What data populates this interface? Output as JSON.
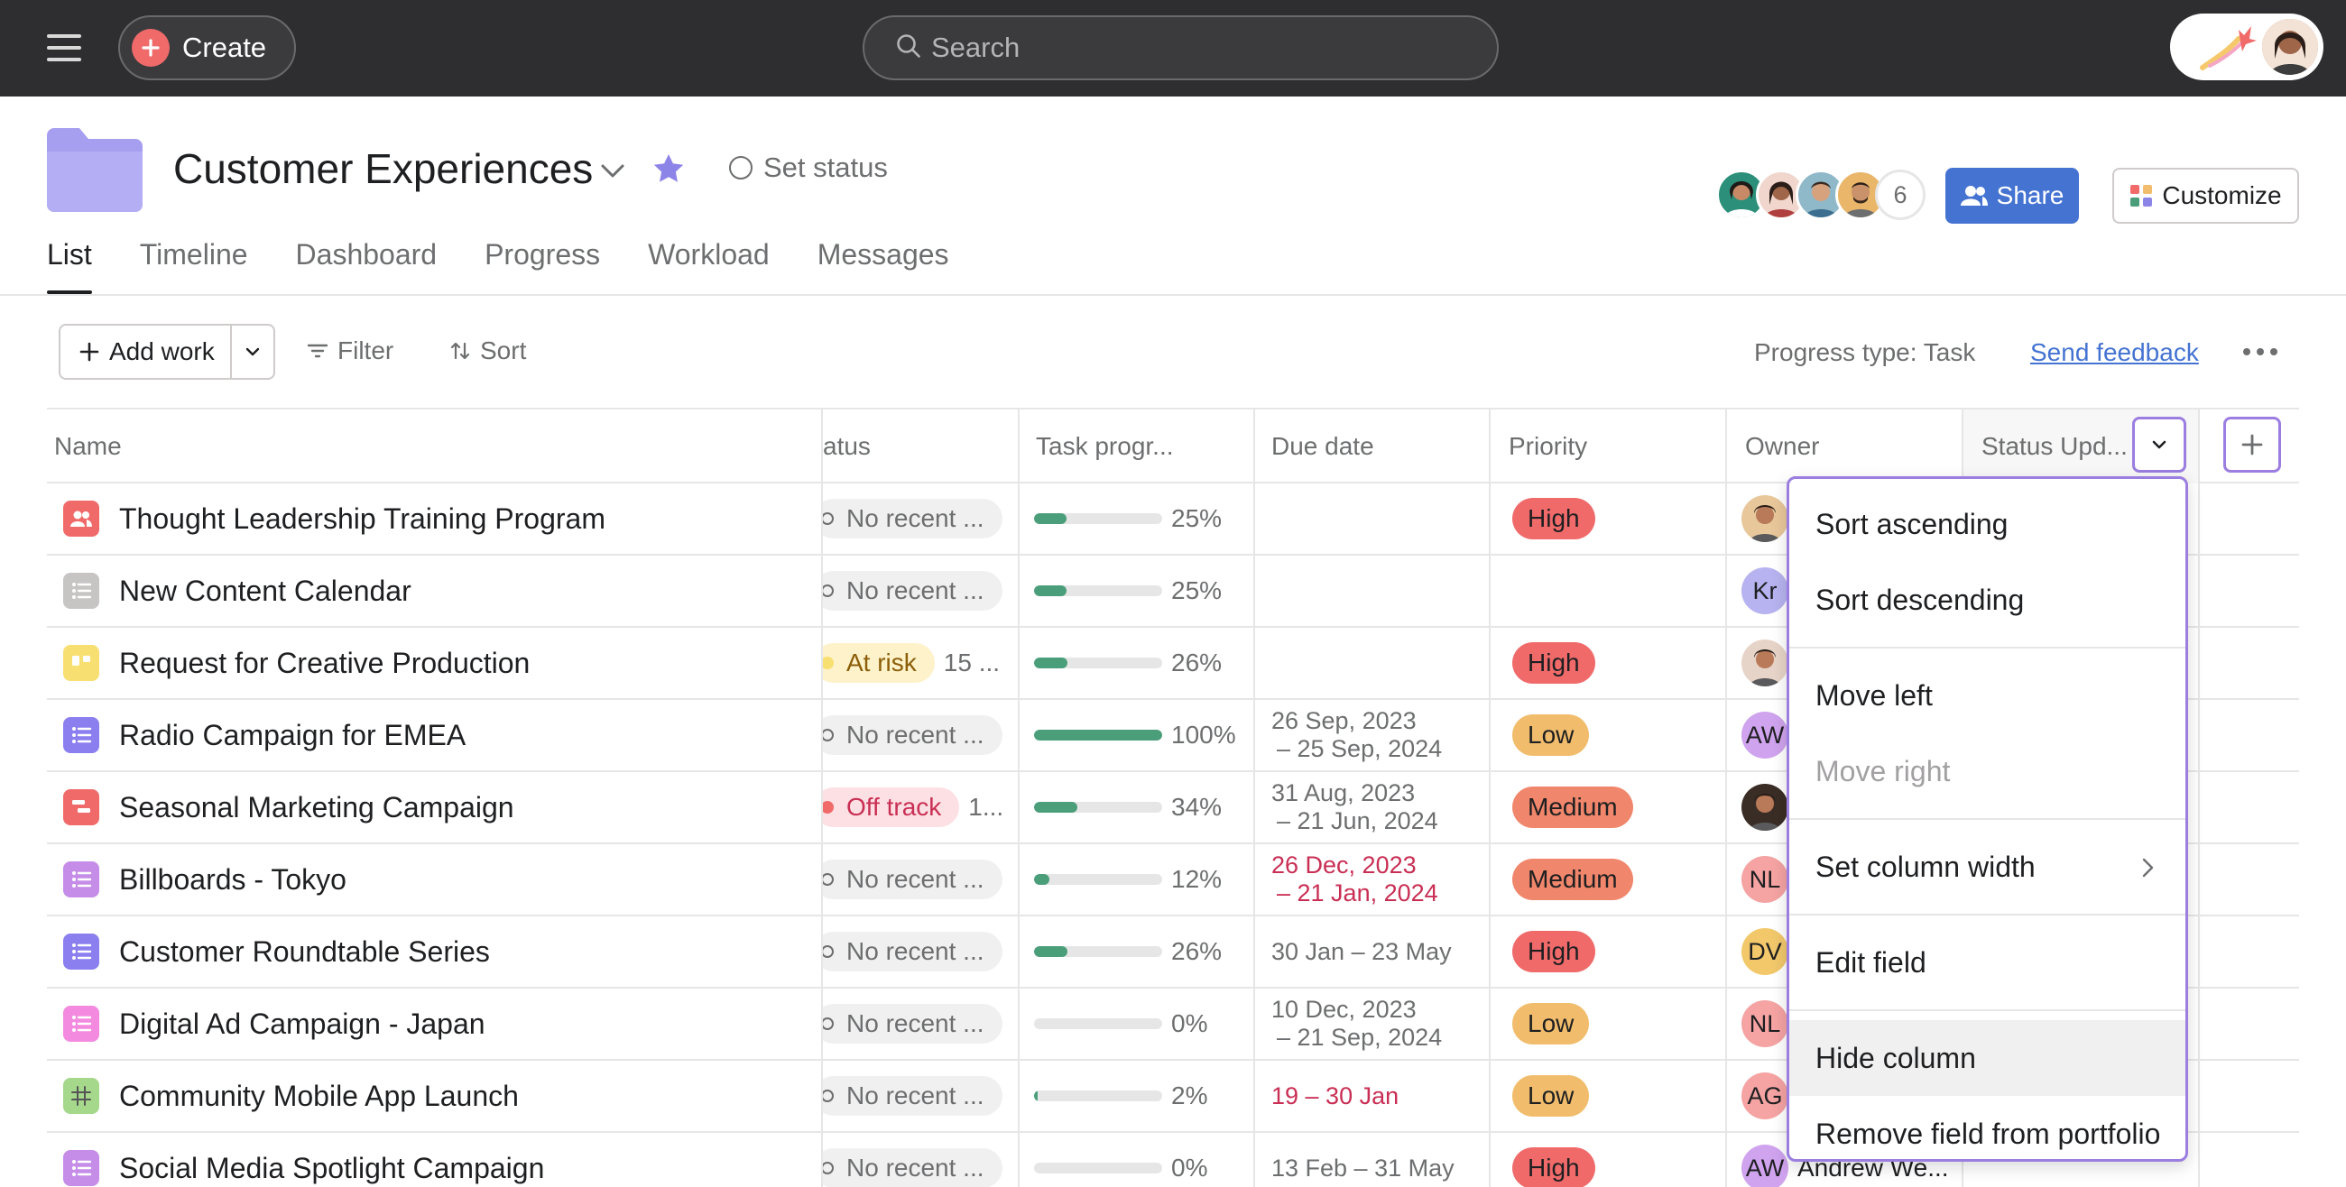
{
  "topbar": {
    "create_label": "Create",
    "search_placeholder": "Search"
  },
  "header": {
    "title": "Customer Experiences",
    "set_status_label": "Set status",
    "member_count": "6",
    "share_label": "Share",
    "customize_label": "Customize",
    "tabs": [
      {
        "label": "List",
        "active": true
      },
      {
        "label": "Timeline"
      },
      {
        "label": "Dashboard"
      },
      {
        "label": "Progress"
      },
      {
        "label": "Workload"
      },
      {
        "label": "Messages"
      }
    ]
  },
  "toolbar": {
    "add_work_label": "Add work",
    "filter_label": "Filter",
    "sort_label": "Sort",
    "progress_type_label": "Progress type: Task",
    "send_feedback_label": "Send feedback"
  },
  "table": {
    "columns": {
      "name": "Name",
      "status": "atus",
      "task_progress": "Task progr...",
      "due_date": "Due date",
      "priority": "Priority",
      "owner": "Owner",
      "status_update": "Status Upd..."
    },
    "rows": [
      {
        "name": "Thought Leadership Training Program",
        "icon_color": "#f06a6a",
        "icon": "people-icon",
        "status": "No recent ...",
        "status_extra": "",
        "progress": "25%",
        "progress_value": 25,
        "due": "",
        "due2": "",
        "priority": "High",
        "owner_initials": "",
        "owner_name": "",
        "owner_color": "#e8c79a"
      },
      {
        "name": "New Content Calendar",
        "icon_color": "#c7c4c4",
        "icon": "list-icon",
        "status": "No recent ...",
        "status_extra": "",
        "progress": "25%",
        "progress_value": 25,
        "due": "",
        "due2": "",
        "priority": "",
        "owner_initials": "Kr",
        "owner_name": "",
        "owner_color": "#b7b3f0"
      },
      {
        "name": "Request for Creative Production",
        "icon_color": "#f8df72",
        "icon": "board-icon",
        "status": "At risk",
        "status_extra": "15 ...",
        "progress": "26%",
        "progress_value": 26,
        "due": "",
        "due2": "",
        "priority": "High",
        "owner_initials": "",
        "owner_name": "",
        "owner_color": "#e7d4c8"
      },
      {
        "name": "Radio Campaign for EMEA",
        "icon_color": "#8b7ff0",
        "icon": "list-icon",
        "status": "No recent ...",
        "status_extra": "",
        "progress": "100%",
        "progress_value": 100,
        "due": "26 Sep, 2023",
        "due2": "– 25 Sep, 2024",
        "priority": "Low",
        "owner_initials": "AW",
        "owner_name": "",
        "owner_color": "#cfa3ee"
      },
      {
        "name": "Seasonal Marketing Campaign",
        "icon_color": "#f06a6a",
        "icon": "timeline-icon",
        "status": "Off track",
        "status_extra": "1...",
        "progress": "34%",
        "progress_value": 34,
        "due": "31 Aug, 2023",
        "due2": "– 21 Jun, 2024",
        "priority": "Medium",
        "owner_initials": "",
        "owner_name": "",
        "owner_color": "#3a2d26"
      },
      {
        "name": "Billboards - Tokyo",
        "icon_color": "#c58de8",
        "icon": "list-icon",
        "status": "No recent ...",
        "status_extra": "",
        "progress": "12%",
        "progress_value": 12,
        "due": "26 Dec, 2023",
        "due2": "– 21 Jan, 2024",
        "due_overdue": true,
        "priority": "Medium",
        "owner_initials": "NL",
        "owner_name": "",
        "owner_color": "#f5a3a3"
      },
      {
        "name": "Customer Roundtable Series",
        "icon_color": "#8b7ff0",
        "icon": "list-icon",
        "status": "No recent ...",
        "status_extra": "",
        "progress": "26%",
        "progress_value": 26,
        "due": "30 Jan – 23 May",
        "due2": "",
        "priority": "High",
        "owner_initials": "DV",
        "owner_name": "",
        "owner_color": "#f2c86b"
      },
      {
        "name": "Digital Ad Campaign - Japan",
        "icon_color": "#f48ae0",
        "icon": "list-icon",
        "status": "No recent ...",
        "status_extra": "",
        "progress": "0%",
        "progress_value": 0,
        "due": "10 Dec, 2023",
        "due2": "– 21 Sep, 2024",
        "priority": "Low",
        "owner_initials": "NL",
        "owner_name": "",
        "owner_color": "#f5a3a3"
      },
      {
        "name": "Community Mobile App Launch",
        "icon_color": "#a5d88a",
        "icon": "grid-icon",
        "status": "No recent ...",
        "status_extra": "",
        "progress": "2%",
        "progress_value": 2,
        "due": "19 – 30 Jan",
        "due2": "",
        "due_overdue": true,
        "priority": "Low",
        "owner_initials": "AG",
        "owner_name": "",
        "owner_color": "#f5a3a3"
      },
      {
        "name": "Social Media Spotlight Campaign",
        "icon_color": "#c58de8",
        "icon": "list-icon",
        "status": "No recent ...",
        "status_extra": "",
        "progress": "0%",
        "progress_value": 0,
        "due": "13 Feb – 31 May",
        "due2": "",
        "priority": "High",
        "owner_initials": "AW",
        "owner_name": "Andrew We...",
        "owner_color": "#cfa3ee"
      }
    ]
  },
  "menu": {
    "sort_ascending": "Sort ascending",
    "sort_descending": "Sort descending",
    "move_left": "Move left",
    "move_right": "Move right",
    "set_column_width": "Set column width",
    "edit_field": "Edit field",
    "hide_column": "Hide column",
    "remove_field": "Remove field from portfolio"
  },
  "colors": {
    "accent": "#9b7ee0",
    "share": "#4573d2",
    "progress_fill": "#4b9e7a",
    "priority_high": "#f06a6a",
    "priority_medium": "#f0866b",
    "priority_low": "#f1bd6c",
    "status_at_risk": "#f8df72",
    "status_off_track": "#f06a6a",
    "overdue_text": "#c92f54"
  }
}
